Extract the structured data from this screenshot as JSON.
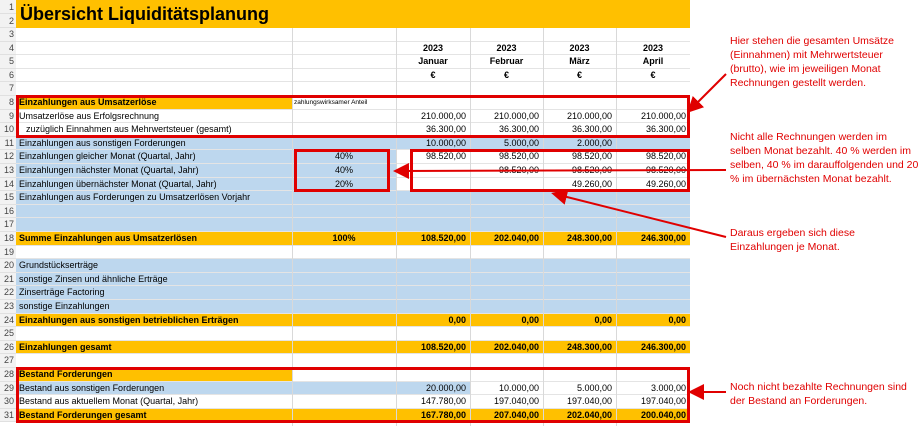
{
  "title": "Übersicht Liquiditätsplanung",
  "year_row": [
    "2023",
    "2023",
    "2023",
    "2023"
  ],
  "months": [
    "Januar",
    "Februar",
    "März",
    "April"
  ],
  "currency_row": [
    "€",
    "€",
    "€",
    "€"
  ],
  "row_numbers": [
    "1",
    "2",
    "3",
    "4",
    "5",
    "6",
    "7",
    "8",
    "9",
    "10",
    "11",
    "12",
    "13",
    "14",
    "15",
    "16",
    "17",
    "18",
    "19",
    "20",
    "21",
    "22",
    "23",
    "24",
    "25",
    "26",
    "27",
    "28",
    "29",
    "30",
    "31"
  ],
  "rows": {
    "r8": {
      "label": "Einzahlungen aus Umsatzerlöse",
      "note": "zahlungswirksamer Anteil"
    },
    "r9": {
      "label": "Umsatzerlöse aus Erfolgsrechnung",
      "values": [
        "210.000,00",
        "210.000,00",
        "210.000,00",
        "210.000,00"
      ]
    },
    "r10": {
      "label": "zuzüglich Einnahmen aus Mehrwertsteuer (gesamt)",
      "values": [
        "36.300,00",
        "36.300,00",
        "36.300,00",
        "36.300,00"
      ]
    },
    "r11": {
      "label": "Einzahlungen aus sonstigen Forderungen",
      "values": [
        "10.000,00",
        "5.000,00",
        "2.000,00",
        ""
      ]
    },
    "r12": {
      "label": "Einzahlungen gleicher Monat (Quartal, Jahr)",
      "pct": "40%",
      "values": [
        "98.520,00",
        "98.520,00",
        "98.520,00",
        "98.520,00"
      ]
    },
    "r13": {
      "label": "Einzahlungen nächster Monat (Quartal, Jahr)",
      "pct": "40%",
      "values": [
        "",
        "98.520,00",
        "98.520,00",
        "98.520,00"
      ]
    },
    "r14": {
      "label": "Einzahlungen übernächster Monat (Quartal, Jahr)",
      "pct": "20%",
      "values": [
        "",
        "",
        "49.260,00",
        "49.260,00"
      ]
    },
    "r15": {
      "label": "Einzahlungen aus Forderungen zu Umsatzerlösen Vorjahr"
    },
    "r18": {
      "label": "Summe Einzahlungen aus Umsatzerlösen",
      "pct": "100%",
      "values": [
        "108.520,00",
        "202.040,00",
        "248.300,00",
        "246.300,00"
      ]
    },
    "r20": {
      "label": "Grundstückserträge"
    },
    "r21": {
      "label": "sonstige Zinsen und ähnliche Erträge"
    },
    "r22": {
      "label": "Zinserträge Factoring"
    },
    "r23": {
      "label": "sonstige Einzahlungen"
    },
    "r24": {
      "label": "Einzahlungen aus sonstigen betrieblichen Erträgen",
      "values": [
        "0,00",
        "0,00",
        "0,00",
        "0,00"
      ]
    },
    "r26": {
      "label": "Einzahlungen gesamt",
      "values": [
        "108.520,00",
        "202.040,00",
        "248.300,00",
        "246.300,00"
      ]
    },
    "r28": {
      "label": "Bestand Forderungen"
    },
    "r29": {
      "label": "Bestand aus sonstigen Forderungen",
      "values": [
        "20.000,00",
        "10.000,00",
        "5.000,00",
        "3.000,00"
      ]
    },
    "r30": {
      "label": "Bestand aus aktuellem Monat (Quartal, Jahr)",
      "values": [
        "147.780,00",
        "197.040,00",
        "197.040,00",
        "197.040,00"
      ]
    },
    "r31": {
      "label": "Bestand Forderungen gesamt",
      "values": [
        "167.780,00",
        "207.040,00",
        "202.040,00",
        "200.040,00"
      ]
    }
  },
  "annotations": {
    "note1": "Hier stehen die gesamten Umsätze (Einnahmen) mit Mehrwertsteuer  (brutto), wie im jeweiligen Monat Rechnungen gestellt werden.",
    "note2": "Nicht alle Rechnungen werden  im selben Monat bezahlt. 40 % werden  im selben, 40 % im darauffolgenden und 20 % im übernächsten Monat bezahlt.",
    "note3": "Daraus ergeben sich diese Einzahlungen je Monat.",
    "note4": "Noch nicht bezahlte Rechnungen sind der Bestand an Forderungen."
  },
  "colors": {
    "accent": "#ffc000",
    "input_fill": "#bdd7ee",
    "highlight": "#e00000"
  }
}
